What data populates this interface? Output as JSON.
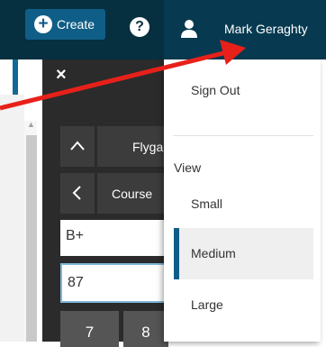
{
  "topbar": {
    "create_label": "Create",
    "help_symbol": "?",
    "user_name": "Mark Geraghty"
  },
  "grade_panel": {
    "close_symbol": "×",
    "row1_label": "Flyga",
    "row2_label": "Course",
    "letter_grade": "B+",
    "score_value": "87",
    "keypad": [
      "7",
      "8"
    ]
  },
  "user_menu": {
    "sign_out_label": "Sign Out",
    "view_heading": "View",
    "view_options": [
      "Small",
      "Medium",
      "Large"
    ],
    "selected_view": "Medium"
  },
  "colors": {
    "topbar_bg": "#062f40",
    "accent": "#0f5e87",
    "annotation_arrow": "#e8201a"
  },
  "icons": [
    "plus-circle-icon",
    "question-circle-icon",
    "user-icon",
    "close-icon",
    "chevron-up-icon",
    "chevron-left-icon"
  ]
}
